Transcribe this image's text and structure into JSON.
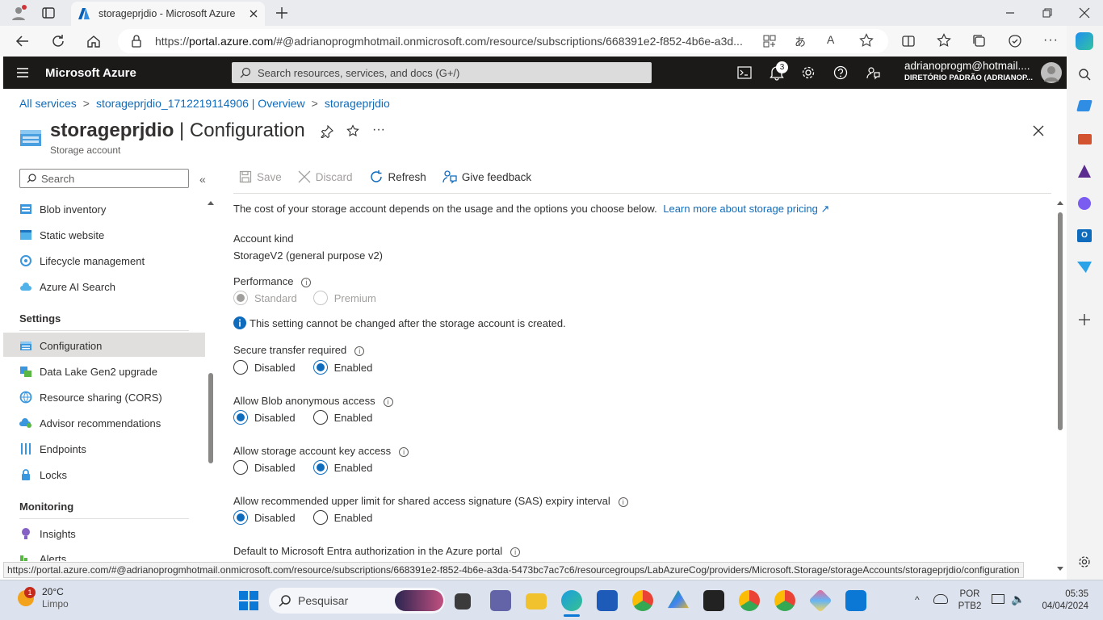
{
  "browser": {
    "tab_title": "storageprjdio - Microsoft Azure",
    "url_prefix": "https://",
    "url_host": "portal.azure.com",
    "url_rest": "/#@adrianoprogmhotmail.onmicrosoft.com/resource/subscriptions/668391e2-f852-4b6e-a3d...",
    "status_url": "https://portal.azure.com/#@adrianoprogmhotmail.onmicrosoft.com/resource/subscriptions/668391e2-f852-4b6e-a3da-5473bc7ac7c6/resourcegroups/LabAzureCog/providers/Microsoft.Storage/storageAccounts/storageprjdio/configuration"
  },
  "azure_header": {
    "brand": "Microsoft Azure",
    "search_placeholder": "Search resources, services, and docs (G+/)",
    "notification_count": "3",
    "account_name": "adrianoprogm@hotmail....",
    "account_directory": "DIRETÓRIO PADRÃO (ADRIANOP..."
  },
  "breadcrumb": [
    "All services",
    "storageprjdio_1712219114906 | Overview",
    "storageprjdio"
  ],
  "breadcrumb_sep": ">",
  "page": {
    "title_bold": "storageprjdio",
    "title_rest": " | Configuration",
    "subtitle": "Storage account"
  },
  "nav": {
    "search_placeholder": "Search",
    "items_top": [
      "Blob inventory",
      "Static website",
      "Lifecycle management",
      "Azure AI Search"
    ],
    "settings_header": "Settings",
    "settings_items": [
      "Configuration",
      "Data Lake Gen2 upgrade",
      "Resource sharing (CORS)",
      "Advisor recommendations",
      "Endpoints",
      "Locks"
    ],
    "monitoring_header": "Monitoring",
    "monitoring_items": [
      "Insights",
      "Alerts"
    ]
  },
  "toolbar": {
    "save": "Save",
    "discard": "Discard",
    "refresh": "Refresh",
    "feedback": "Give feedback"
  },
  "content": {
    "intro": "The cost of your storage account depends on the usage and the options you choose below.",
    "intro_link": "Learn more about storage pricing",
    "account_kind_label": "Account kind",
    "account_kind_value": "StorageV2 (general purpose v2)",
    "performance_label": "Performance",
    "performance_options": [
      "Standard",
      "Premium"
    ],
    "performance_selected": "Standard",
    "performance_note": "This setting cannot be changed after the storage account is created.",
    "secure_transfer_label": "Secure transfer required",
    "secure_transfer_selected": "Enabled",
    "blob_anon_label": "Allow Blob anonymous access",
    "blob_anon_selected": "Disabled",
    "key_access_label": "Allow storage account key access",
    "key_access_selected": "Enabled",
    "sas_label": "Allow recommended upper limit for shared access signature (SAS) expiry interval",
    "sas_selected": "Disabled",
    "entra_label": "Default to Microsoft Entra authorization in the Azure portal",
    "opt_disabled": "Disabled",
    "opt_enabled": "Enabled"
  },
  "taskbar": {
    "weather_temp": "20°C",
    "weather_desc": "Limpo",
    "weather_badge": "1",
    "search_placeholder": "Pesquisar",
    "lang_1": "POR",
    "lang_2": "PTB2",
    "time": "05:35",
    "date": "04/04/2024"
  },
  "colors": {
    "azure_header_bg": "#1b1a19",
    "link_blue": "#0f6cbd",
    "nav_selected_bg": "#e1dfdd"
  }
}
